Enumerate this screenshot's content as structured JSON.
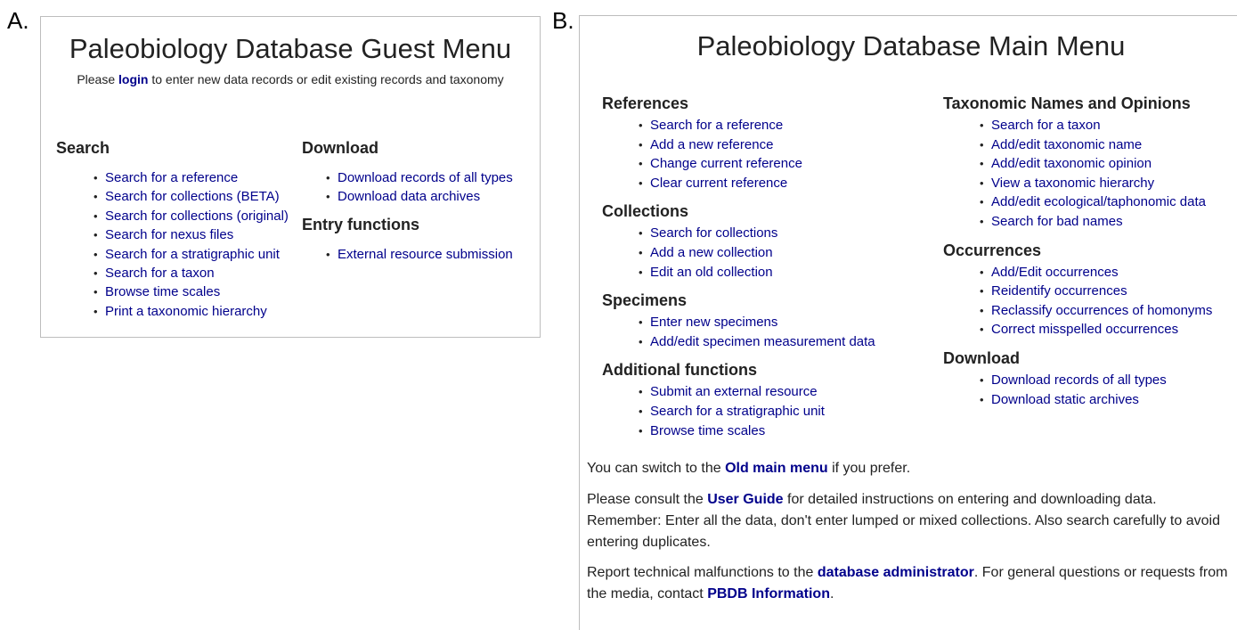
{
  "panel_a_label": "A.",
  "panel_b_label": "B.",
  "guest": {
    "title": "Paleobiology Database Guest Menu",
    "note_pre": "Please ",
    "note_link": "login",
    "note_post": " to enter new data records or edit existing records and taxonomy",
    "search": {
      "heading": "Search",
      "items": [
        "Search for a reference",
        "Search for collections (BETA)",
        "Search for collections (original)",
        "Search for nexus files",
        "Search for a stratigraphic unit",
        "Search for a taxon",
        "Browse time scales",
        "Print a taxonomic hierarchy"
      ]
    },
    "download": {
      "heading": "Download",
      "items": [
        "Download records of all types",
        "Download data archives"
      ]
    },
    "entry": {
      "heading": "Entry functions",
      "items": [
        "External resource submission"
      ]
    }
  },
  "main": {
    "title": "Paleobiology Database Main Menu",
    "references": {
      "heading": "References",
      "items": [
        "Search for a reference",
        "Add a new reference",
        "Change current reference",
        "Clear current reference"
      ]
    },
    "collections": {
      "heading": "Collections",
      "items": [
        "Search for collections",
        "Add a new collection",
        "Edit an old collection"
      ]
    },
    "specimens": {
      "heading": "Specimens",
      "items": [
        "Enter new specimens",
        "Add/edit specimen measurement data"
      ]
    },
    "additional": {
      "heading": "Additional functions",
      "items": [
        "Submit an external resource",
        "Search for a stratigraphic unit",
        "Browse time scales"
      ]
    },
    "taxonomic": {
      "heading": "Taxonomic Names and Opinions",
      "items": [
        "Search for a taxon",
        "Add/edit taxonomic name",
        "Add/edit taxonomic opinion",
        "View a taxonomic hierarchy",
        "Add/edit ecological/taphonomic data",
        "Search for bad names"
      ]
    },
    "occurrences": {
      "heading": "Occurrences",
      "items": [
        "Add/Edit occurrences",
        "Reidentify occurrences",
        "Reclassify occurrences of homonyms",
        "Correct misspelled occurrences"
      ]
    },
    "download": {
      "heading": "Download",
      "items": [
        "Download records of all types",
        "Download static archives"
      ]
    },
    "switch_pre": "You can switch to the ",
    "switch_link": "Old main menu",
    "switch_post": " if you prefer.",
    "consult_pre": "Please consult the ",
    "consult_link": "User Guide",
    "consult_post": " for detailed instructions on entering and downloading data. Remember: Enter all the data, don't enter lumped or mixed collections. Also search carefully to avoid entering duplicates.",
    "report_pre": "Report technical malfunctions to the ",
    "report_link": "database administrator",
    "report_mid": ". For general questions or requests from the media, contact ",
    "report_link2": "PBDB Information",
    "report_post": "."
  }
}
